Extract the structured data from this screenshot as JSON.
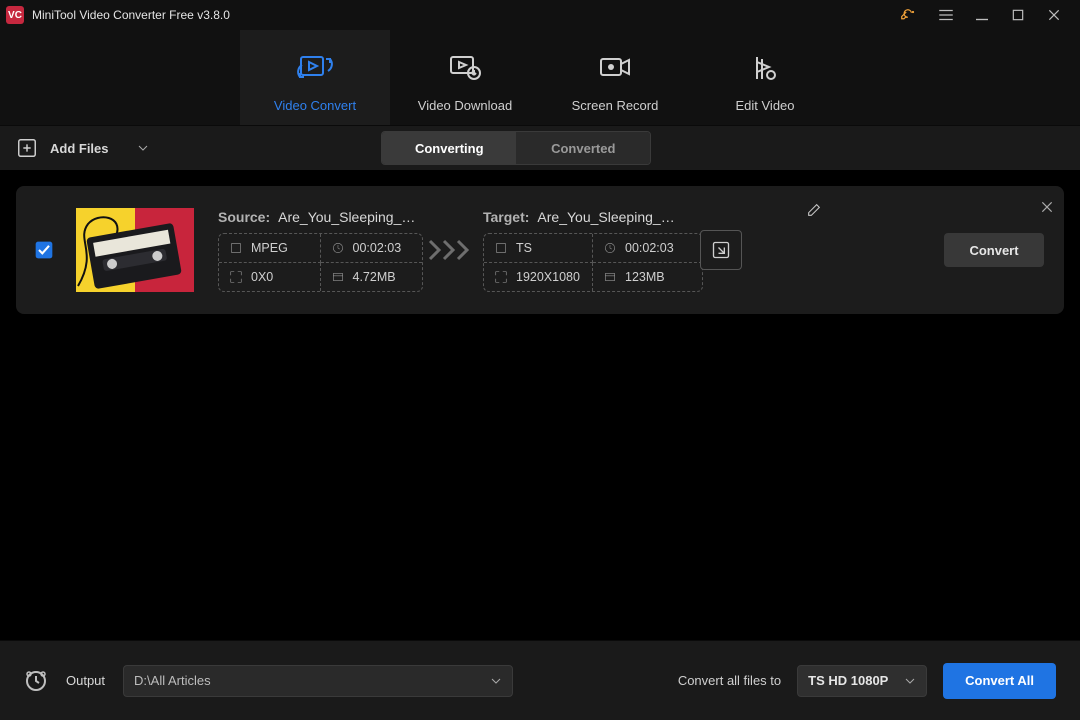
{
  "titlebar": {
    "app_glyph": "VC",
    "title": "MiniTool Video Converter Free v3.8.0"
  },
  "nav": {
    "items": [
      {
        "label": "Video Convert"
      },
      {
        "label": "Video Download"
      },
      {
        "label": "Screen Record"
      },
      {
        "label": "Edit Video"
      }
    ]
  },
  "toolbar": {
    "add_files_label": "Add Files",
    "subtabs": {
      "converting": "Converting",
      "converted": "Converted"
    }
  },
  "task": {
    "source_label": "Source:",
    "target_label": "Target:",
    "source_name": "Are_You_Sleeping_In...",
    "target_name": "Are_You_Sleeping_In...",
    "source": {
      "format": "MPEG",
      "duration": "00:02:03",
      "resolution": "0X0",
      "size": "4.72MB"
    },
    "target": {
      "format": "TS",
      "duration": "00:02:03",
      "resolution": "1920X1080",
      "size": "123MB"
    },
    "convert_label": "Convert"
  },
  "bottombar": {
    "output_label": "Output",
    "output_path": "D:\\All Articles",
    "convert_all_label": "Convert all files to",
    "target_preset": "TS HD 1080P",
    "convert_all_btn": "Convert All"
  }
}
